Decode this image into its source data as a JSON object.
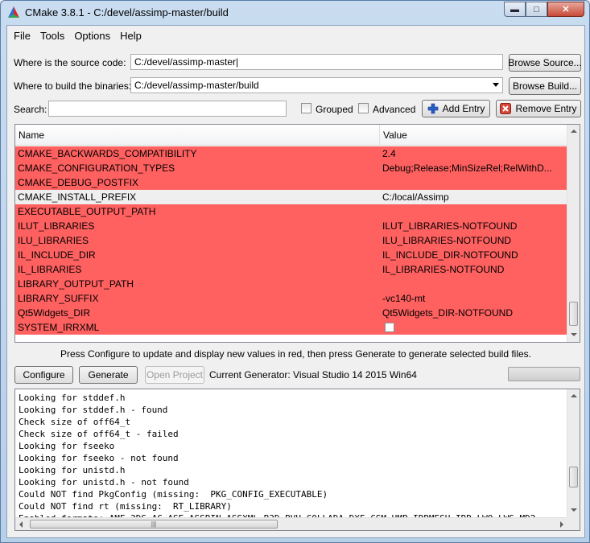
{
  "window": {
    "title": "CMake 3.8.1 - C:/devel/assimp-master/build"
  },
  "menu": [
    "File",
    "Tools",
    "Options",
    "Help"
  ],
  "source": {
    "label": "Where is the source code:",
    "value": "C:/devel/assimp-master|",
    "browse": "Browse Source..."
  },
  "build": {
    "label": "Where to build the binaries:",
    "value": "C:/devel/assimp-master/build",
    "browse": "Browse Build..."
  },
  "search": {
    "label": "Search:",
    "value": ""
  },
  "options": {
    "grouped": "Grouped",
    "advanced": "Advanced",
    "add_entry": "Add Entry",
    "remove_entry": "Remove Entry"
  },
  "table": {
    "headers": {
      "name": "Name",
      "value": "Value"
    },
    "rows": [
      {
        "name": "CMAKE_BACKWARDS_COMPATIBILITY",
        "value": "2.4",
        "state": "red"
      },
      {
        "name": "CMAKE_CONFIGURATION_TYPES",
        "value": "Debug;Release;MinSizeRel;RelWithD...",
        "state": "red"
      },
      {
        "name": "CMAKE_DEBUG_POSTFIX",
        "value": "",
        "state": "red"
      },
      {
        "name": "CMAKE_INSTALL_PREFIX",
        "value": "C:/local/Assimp",
        "state": "white"
      },
      {
        "name": "EXECUTABLE_OUTPUT_PATH",
        "value": "",
        "state": "red"
      },
      {
        "name": "ILUT_LIBRARIES",
        "value": "ILUT_LIBRARIES-NOTFOUND",
        "state": "red"
      },
      {
        "name": "ILU_LIBRARIES",
        "value": "ILU_LIBRARIES-NOTFOUND",
        "state": "red"
      },
      {
        "name": "IL_INCLUDE_DIR",
        "value": "IL_INCLUDE_DIR-NOTFOUND",
        "state": "red"
      },
      {
        "name": "IL_LIBRARIES",
        "value": "IL_LIBRARIES-NOTFOUND",
        "state": "red"
      },
      {
        "name": "LIBRARY_OUTPUT_PATH",
        "value": "",
        "state": "red"
      },
      {
        "name": "LIBRARY_SUFFIX",
        "value": "-vc140-mt",
        "state": "red"
      },
      {
        "name": "Qt5Widgets_DIR",
        "value": "Qt5Widgets_DIR-NOTFOUND",
        "state": "red"
      },
      {
        "name": "SYSTEM_IRRXML",
        "value": "",
        "state": "red",
        "checkbox": true
      }
    ]
  },
  "hint": "Press Configure to update and display new values in red, then press Generate to generate selected build files.",
  "actions": {
    "configure": "Configure",
    "generate": "Generate",
    "open_project": "Open Project",
    "generator": "Current Generator: Visual Studio 14 2015 Win64"
  },
  "log": [
    "Looking for stddef.h",
    "Looking for stddef.h - found",
    "Check size of off64_t",
    "Check size of off64_t - failed",
    "Looking for fseeko",
    "Looking for fseeko - not found",
    "Looking for unistd.h",
    "Looking for unistd.h - not found",
    "Could NOT find PkgConfig (missing:  PKG_CONFIG_EXECUTABLE)",
    "Could NOT find rt (missing:  RT_LIBRARY)",
    "Enabled formats: AMF 3DS AC ASE ASSBIN ASSXML B3D BVH COLLADA DXF CSM HMP IRRMESH IRR LWO LWS MD2"
  ],
  "colors": {
    "changed_row": "#ff6060",
    "normal_row": "#efefef"
  }
}
